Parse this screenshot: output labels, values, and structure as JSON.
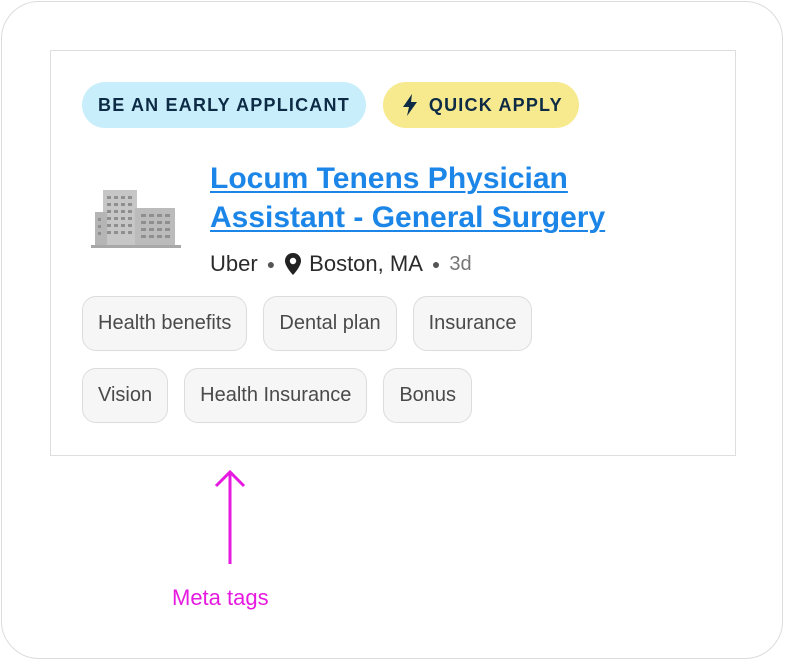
{
  "badges": {
    "early_applicant": "BE AN EARLY APPLICANT",
    "quick_apply": "QUICK APPLY"
  },
  "job": {
    "title": "Locum Tenens Physician Assistant - General Surgery",
    "company": "Uber",
    "location": "Boston, MA",
    "posted": "3d"
  },
  "tags": {
    "row1": [
      "Health benefits",
      "Dental plan",
      "Insurance"
    ],
    "row2": [
      "Vision",
      "Health Insurance",
      "Bonus"
    ]
  },
  "annotation": {
    "label": "Meta tags",
    "color": "#e619e0"
  },
  "icons": {
    "quick_apply": "lightning-bolt-icon",
    "location": "map-pin-icon",
    "company_logo": "building-icon"
  },
  "colors": {
    "early_badge_bg": "#c8eefb",
    "quick_badge_bg": "#f7e98e",
    "title_link": "#1b86e8"
  }
}
